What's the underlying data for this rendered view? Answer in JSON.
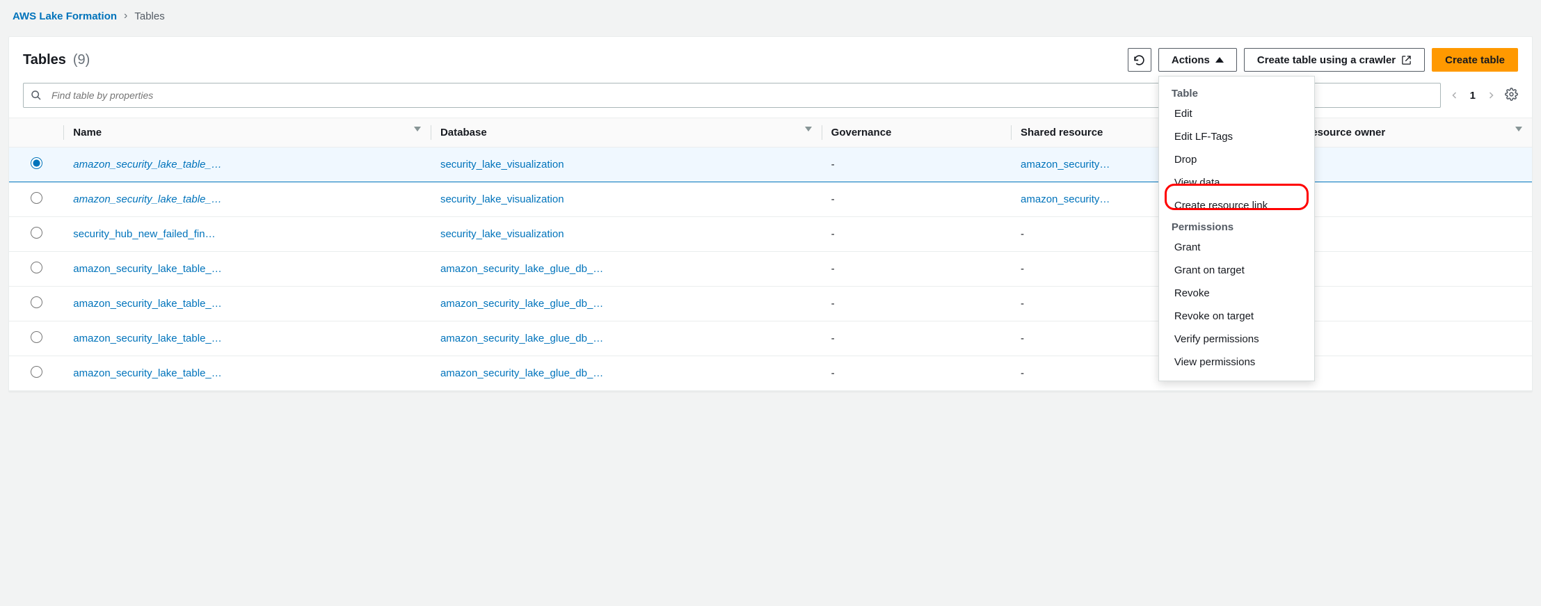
{
  "breadcrumb": {
    "root": "AWS Lake Formation",
    "current": "Tables"
  },
  "panel": {
    "title": "Tables",
    "count": "(9)"
  },
  "buttons": {
    "actions": "Actions",
    "crawler": "Create table using a crawler",
    "create": "Create table"
  },
  "search": {
    "placeholder": "Find table by properties"
  },
  "pagination": {
    "page": "1"
  },
  "columns": {
    "name": "Name",
    "database": "Database",
    "governance": "Governance",
    "shared_resource": "Shared resource",
    "owner": "Shared resource owner"
  },
  "rows": [
    {
      "selected": true,
      "italic": true,
      "name": "amazon_security_lake_table_…",
      "db": "security_lake_visualization",
      "db_link": true,
      "gov": "-",
      "shared": "amazon_security…",
      "shared_link": true,
      "owner": ""
    },
    {
      "selected": false,
      "italic": true,
      "name": "amazon_security_lake_table_…",
      "db": "security_lake_visualization",
      "db_link": true,
      "gov": "-",
      "shared": "amazon_security…",
      "shared_link": true,
      "owner": ""
    },
    {
      "selected": false,
      "italic": false,
      "name": "security_hub_new_failed_fin…",
      "db": "security_lake_visualization",
      "db_link": true,
      "gov": "-",
      "shared": "-",
      "shared_link": false,
      "owner": "-"
    },
    {
      "selected": false,
      "italic": false,
      "name": "amazon_security_lake_table_…",
      "db": "amazon_security_lake_glue_db_…",
      "db_link": true,
      "gov": "-",
      "shared": "-",
      "shared_link": false,
      "owner": "-"
    },
    {
      "selected": false,
      "italic": false,
      "name": "amazon_security_lake_table_…",
      "db": "amazon_security_lake_glue_db_…",
      "db_link": true,
      "gov": "-",
      "shared": "-",
      "shared_link": false,
      "owner": "-"
    },
    {
      "selected": false,
      "italic": false,
      "name": "amazon_security_lake_table_…",
      "db": "amazon_security_lake_glue_db_…",
      "db_link": true,
      "gov": "-",
      "shared": "-",
      "shared_link": false,
      "owner": "-"
    },
    {
      "selected": false,
      "italic": false,
      "name": "amazon_security_lake_table_…",
      "db": "amazon_security_lake_glue_db_…",
      "db_link": true,
      "gov": "-",
      "shared": "-",
      "shared_link": false,
      "owner": "-"
    }
  ],
  "dropdown": {
    "section1_title": "Table",
    "section1_items": [
      "Edit",
      "Edit LF-Tags",
      "Drop",
      "View data",
      "Create resource link"
    ],
    "section2_title": "Permissions",
    "section2_items": [
      "Grant",
      "Grant on target",
      "Revoke",
      "Revoke on target",
      "Verify permissions",
      "View permissions"
    ]
  }
}
